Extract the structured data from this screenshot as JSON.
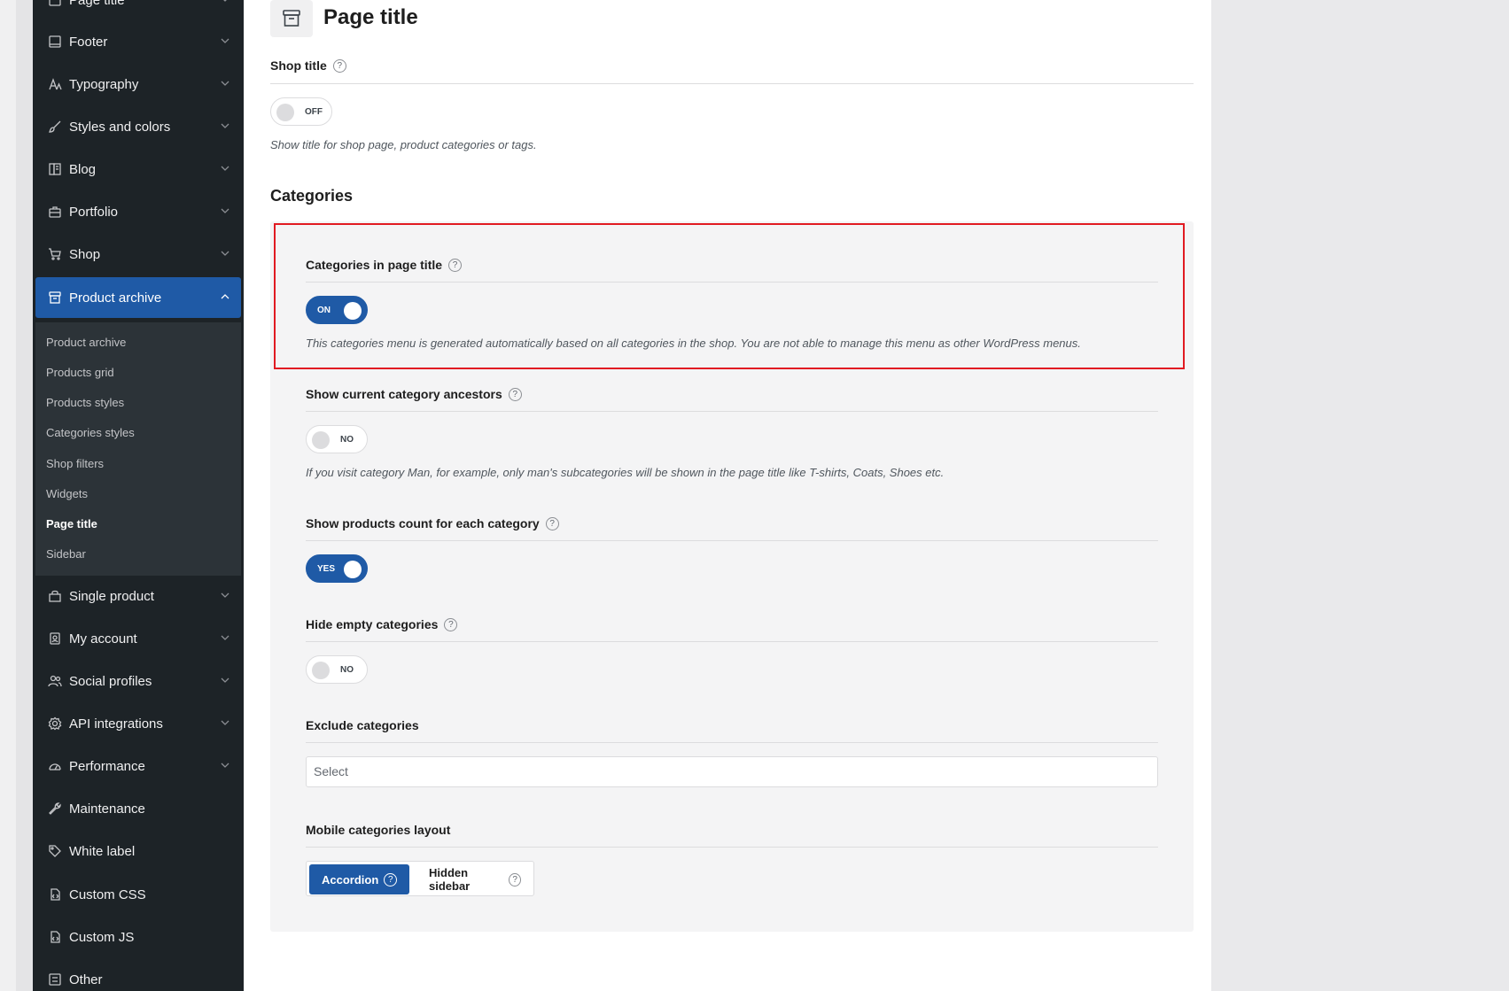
{
  "sidebar": {
    "items": [
      {
        "label": "Page title",
        "icon": "layout-icon"
      },
      {
        "label": "Footer",
        "icon": "footer-icon"
      },
      {
        "label": "Typography",
        "icon": "typography-icon"
      },
      {
        "label": "Styles and colors",
        "icon": "brush-icon"
      },
      {
        "label": "Blog",
        "icon": "blog-icon"
      },
      {
        "label": "Portfolio",
        "icon": "portfolio-icon"
      },
      {
        "label": "Shop",
        "icon": "cart-icon"
      },
      {
        "label": "Product archive",
        "icon": "archive-icon"
      },
      {
        "label": "Single product",
        "icon": "bag-icon"
      },
      {
        "label": "My account",
        "icon": "account-icon"
      },
      {
        "label": "Social profiles",
        "icon": "users-icon"
      },
      {
        "label": "API integrations",
        "icon": "gear-icon"
      },
      {
        "label": "Performance",
        "icon": "gauge-icon"
      },
      {
        "label": "Maintenance",
        "icon": "wrench-icon"
      },
      {
        "label": "White label",
        "icon": "tag-icon"
      },
      {
        "label": "Custom CSS",
        "icon": "css-icon"
      },
      {
        "label": "Custom JS",
        "icon": "js-icon"
      },
      {
        "label": "Other",
        "icon": "other-icon"
      }
    ],
    "submenu": [
      "Product archive",
      "Products grid",
      "Products styles",
      "Categories styles",
      "Shop filters",
      "Widgets",
      "Page title",
      "Sidebar"
    ]
  },
  "main": {
    "title": "Page title",
    "shop_title": {
      "label": "Shop title",
      "help": "?",
      "toggle": "OFF",
      "description": "Show title for shop page, product categories or tags."
    },
    "categories_heading": "Categories",
    "fields": {
      "categories_in_title": {
        "label": "Categories in page title",
        "help": "?",
        "toggle": "ON",
        "description": "This categories menu is generated automatically based on all categories in the shop. You are not able to manage this menu as other WordPress menus."
      },
      "ancestors": {
        "label": "Show current category ancestors",
        "help": "?",
        "toggle": "NO",
        "description": "If you visit category Man, for example, only man's subcategories will be shown in the page title like T-shirts, Coats, Shoes etc."
      },
      "products_count": {
        "label": "Show products count for each category",
        "help": "?",
        "toggle": "YES"
      },
      "hide_empty": {
        "label": "Hide empty categories",
        "help": "?",
        "toggle": "NO"
      },
      "exclude": {
        "label": "Exclude categories",
        "placeholder": "Select"
      },
      "mobile_layout": {
        "label": "Mobile categories layout",
        "options": [
          "Accordion",
          "Hidden sidebar"
        ],
        "help": "?"
      }
    }
  },
  "colors": {
    "accent": "#1f5aa6",
    "sidebar_bg": "#1d2327",
    "highlight_border": "#e11b22"
  }
}
